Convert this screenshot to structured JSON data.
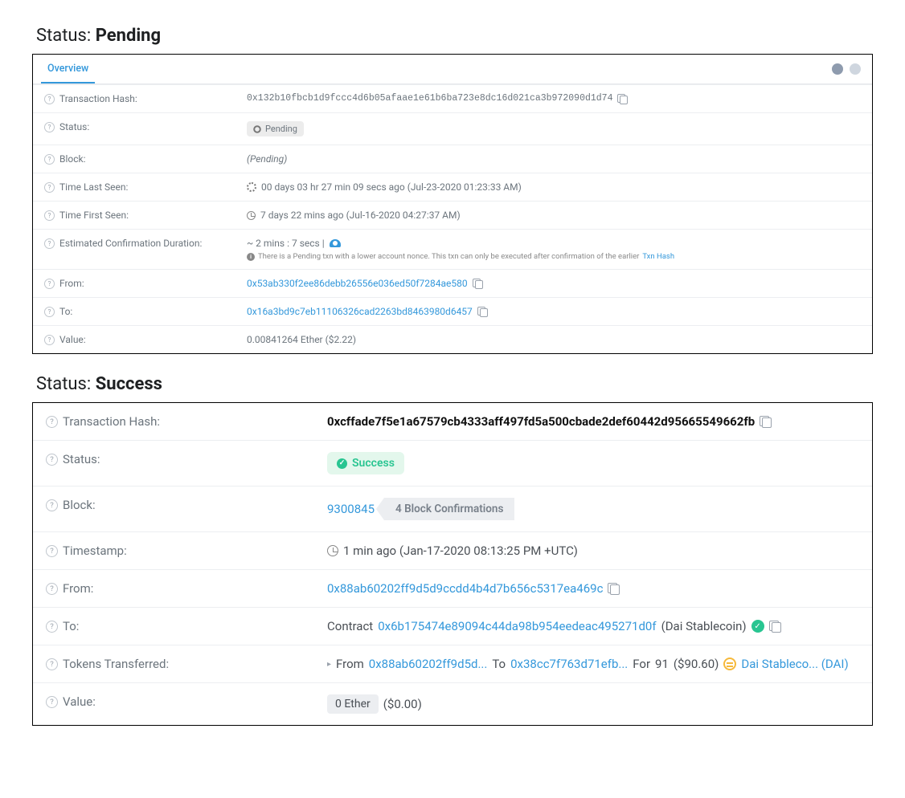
{
  "headings": {
    "pending_prefix": "Status: ",
    "pending_bold": "Pending",
    "success_prefix": "Status: ",
    "success_bold": "Success"
  },
  "pending": {
    "tab": "Overview",
    "labels": {
      "txn_hash": "Transaction Hash:",
      "status": "Status:",
      "block": "Block:",
      "time_last_seen": "Time Last Seen:",
      "time_first_seen": "Time First Seen:",
      "est_conf": "Estimated Confirmation Duration:",
      "from": "From:",
      "to": "To:",
      "value": "Value:"
    },
    "values": {
      "txn_hash": "0x132b10fbcb1d9fccc4d6b05afaae1e61b6ba723e8dc16d021ca3b972090d1d74",
      "status_badge": "Pending",
      "block": "(Pending)",
      "time_last_seen": "00 days 03 hr 27 min 09 secs ago (Jul-23-2020 01:23:33 AM)",
      "time_first_seen": "7 days 22 mins ago (Jul-16-2020 04:27:37 AM)",
      "est_conf_line1": "~ 2 mins : 7 secs |",
      "est_conf_note": "There is a Pending txn with a lower account nonce. This txn can only be executed after confirmation of the earlier",
      "est_conf_note_link": "Txn Hash",
      "from": "0x53ab330f2ee86debb26556e036ed50f7284ae580",
      "to": "0x16a3bd9c7eb11106326cad2263bd8463980d6457",
      "value": "0.00841264 Ether ($2.22)"
    }
  },
  "success": {
    "labels": {
      "txn_hash": "Transaction Hash:",
      "status": "Status:",
      "block": "Block:",
      "timestamp": "Timestamp:",
      "from": "From:",
      "to": "To:",
      "tokens": "Tokens Transferred:",
      "value": "Value:"
    },
    "values": {
      "txn_hash": "0xcffade7f5e1a67579cb4333aff497fd5a500cbade2def60442d95665549662fb",
      "status_badge": "Success",
      "block": "9300845",
      "block_conf": "4 Block Confirmations",
      "timestamp": "1 min ago (Jan-17-2020 08:13:25 PM +UTC)",
      "from": "0x88ab60202ff9d5d9ccdd4b4d7b656c5317ea469c",
      "to_prefix": "Contract",
      "to_addr": "0x6b175474e89094c44da98b954eedeac495271d0f",
      "to_suffix": "(Dai Stablecoin)",
      "tokens_from_label": "From",
      "tokens_from_addr": "0x88ab60202ff9d5d...",
      "tokens_to_label": "To",
      "tokens_to_addr": "0x38cc7f763d71efb...",
      "tokens_for_label": "For",
      "tokens_amount": "91",
      "tokens_usd": "($90.60)",
      "tokens_symbol": "Dai Stableco... (DAI)",
      "value_pill": "0 Ether",
      "value_usd": "($0.00)"
    }
  }
}
